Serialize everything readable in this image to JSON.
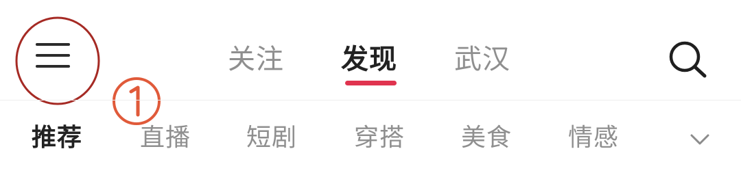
{
  "header": {
    "menu_icon": "hamburger-menu-icon",
    "search_icon": "search-icon",
    "tabs": [
      {
        "label": "关注",
        "active": false
      },
      {
        "label": "发现",
        "active": true
      },
      {
        "label": "武汉",
        "active": false
      }
    ]
  },
  "annotation": {
    "number": "①",
    "color": "#c0302a"
  },
  "categories": {
    "items": [
      {
        "label": "推荐",
        "active": true
      },
      {
        "label": "直播",
        "active": false
      },
      {
        "label": "短剧",
        "active": false
      },
      {
        "label": "穿搭",
        "active": false
      },
      {
        "label": "美食",
        "active": false
      },
      {
        "label": "情感",
        "active": false
      }
    ],
    "expand_icon": "chevron-down-icon"
  },
  "colors": {
    "accent": "#e0344f",
    "active_text": "#222222",
    "inactive_text": "#8f8f8f",
    "annotation": "#c0302a"
  }
}
